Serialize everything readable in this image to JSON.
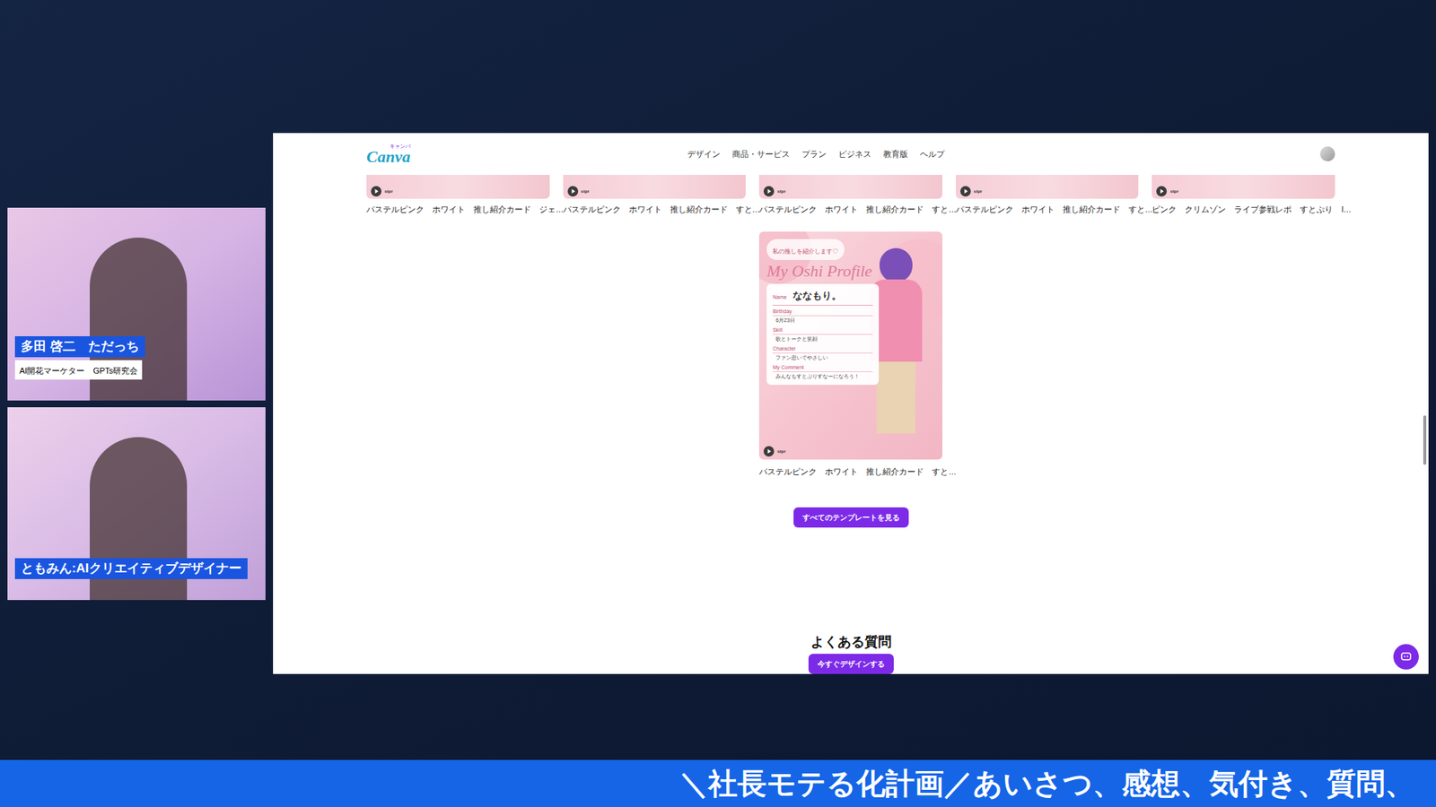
{
  "stream": {
    "participants": [
      {
        "name": "多田 啓二　ただっち",
        "subtitle": "AI開花マーケター　GPTs研究会"
      },
      {
        "name": "ともみん:AIクリエイティブデザイナー",
        "subtitle": ""
      }
    ],
    "ticker": "＼社長モテる化計画／あいさつ、感想、気付き、質問、"
  },
  "browser": {
    "logo": "Canva",
    "logo_kana": "キャンバ",
    "nav": [
      "デザイン",
      "商品・サービス",
      "プラン",
      "ビジネス",
      "教育版",
      "ヘルプ"
    ],
    "top_templates": [
      {
        "label": "パステルピンク　ホワイト　推し紹介カード　ジェ…",
        "brand": "stpr"
      },
      {
        "label": "パステルピンク　ホワイト　推し紹介カード　すと…",
        "brand": "stpr"
      },
      {
        "label": "パステルピンク　ホワイト　推し紹介カード　すと…",
        "brand": "stpr"
      },
      {
        "label": "パステルピンク　ホワイト　推し紹介カード　すと…",
        "brand": "stpr"
      },
      {
        "label": "ピンク　クリムゾン　ライブ参戦レポ　すとぷり　I…",
        "brand": "stpr"
      }
    ],
    "featured_template": {
      "label": "パステルピンク　ホワイト　推し紹介カード　すと…",
      "brand": "stpr",
      "card": {
        "tagline": "私の推しを紹介します♡",
        "title": "My Oshi Profile",
        "name_label": "Name",
        "name": "ななもり。",
        "fields": [
          {
            "label": "Birthday",
            "value": "6月23日"
          },
          {
            "label": "Skill",
            "value": "歌とトークと笑顔"
          },
          {
            "label": "Character",
            "value": "ファン思いでやさしい"
          },
          {
            "label": "My Comment",
            "value": "みんなもすとぷりすなーになろう！"
          }
        ]
      }
    },
    "see_all_button": "すべてのテンプレートを見る",
    "section_heading": "よくある質問",
    "cta_button": "今すぐデザインする"
  }
}
